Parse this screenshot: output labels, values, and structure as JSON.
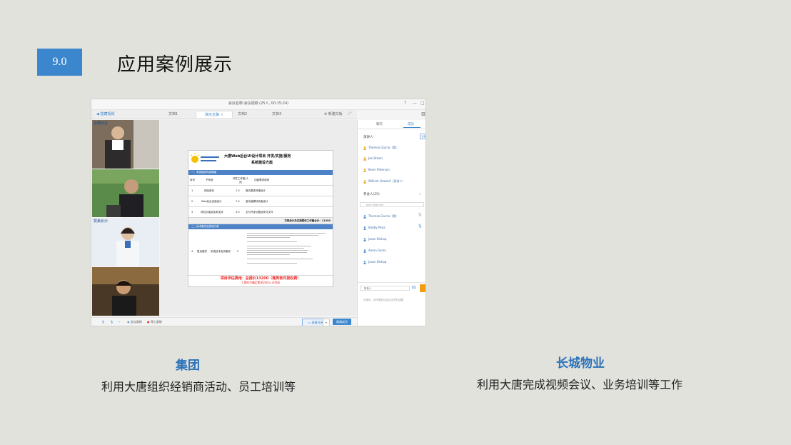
{
  "header": {
    "section_number": "9.0",
    "title": "应用案例展示"
  },
  "screenshot": {
    "window_title": "会议名称:会议视频 (25人, 00:15:24)",
    "window_buttons": [
      "?",
      "—",
      "□"
    ],
    "back_label": "隐藏视频",
    "tabs": [
      {
        "label": "文档1",
        "active": false
      },
      {
        "label": "演示文稿",
        "active": true
      },
      {
        "label": "文档2",
        "active": false
      },
      {
        "label": "文档3",
        "active": false
      }
    ],
    "new_whiteboard": "新建白板",
    "videos": [
      {
        "label": "会畅创业"
      },
      {
        "label": ""
      },
      {
        "label": "赞美长沙"
      },
      {
        "label": ""
      }
    ],
    "document": {
      "heading_line1": "大唐Web后台UI设计项目    开发/实施/服务",
      "heading_line2": "系统建设方案",
      "section1": "一、系统建设内容明细",
      "columns": [
        "序号",
        "子系统",
        "开发工作量(人天)",
        "功能需求说明"
      ],
      "rows": [
        {
          "no": "1",
          "name": "网站首页",
          "days": "1.0",
          "desc": "首页整体风格设计"
        },
        {
          "no": "2",
          "name": "Web后台页面设计",
          "days": "7.0",
          "desc": "各功能模块页面设计"
        },
        {
          "no": "3",
          "name": "项目交接及技术支持",
          "days": "3.0",
          "desc": "交付开发切图及样式文件"
        }
      ],
      "total_line": "方案设计及实施整体工作量合计：11300",
      "section2": "二、技术服务及其他方案",
      "row4": {
        "no": "4",
        "name": "售后服务",
        "sub": "系统技术支持服务",
        "days": "2"
      },
      "price_line": "项目评估费用：总报价13200（微笑软件授权费）",
      "schedule_line": "工期约为确定需求后的11天完成"
    },
    "bottom": {
      "mic_label": "静音",
      "record_label": "会议录制",
      "stop_label": "停止录制",
      "share_label": "屏幕共享",
      "invite_label": "邀请成员"
    },
    "panel": {
      "tabs": [
        "聊天",
        "成员"
      ],
      "presenter_section": "演讲人",
      "presenter_chip": "管理",
      "presenters": [
        "Theresa Garcia（我）",
        "Joe Brown",
        "Kevin Peterson",
        "William Howard（演讲人）"
      ],
      "members_section": "参会人(25)",
      "search_placeholder": "Jane Searcher",
      "members": [
        "Theresa Garcia（我）",
        "Bobby Pena",
        "Jason Bishop",
        "Aaron Garza",
        "Jason Bishop"
      ],
      "message_target": "所有人",
      "message_placeholder": "大家好，请不要说与会议无关的话题"
    }
  },
  "captions": [
    {
      "title": "集团",
      "desc": "利用大唐组织经销商活动、员工培训等"
    },
    {
      "title": "长城物业",
      "desc": "利用大唐完成视频会议、业务培训等工作"
    }
  ],
  "colors": {
    "accent": "#3b86cc",
    "caption_title": "#2e73b8",
    "background": "#e2e2dd",
    "badge_chevron": "#8a8a8a"
  }
}
